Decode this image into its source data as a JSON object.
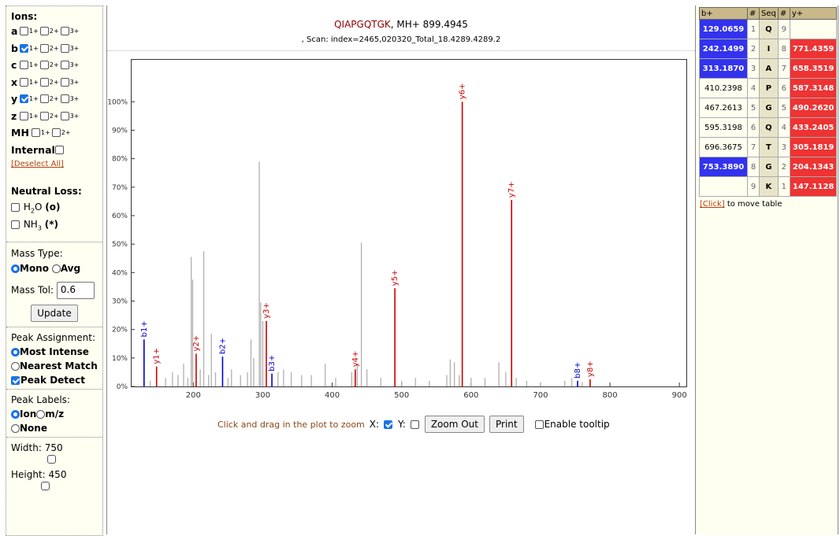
{
  "ions": {
    "heading": "Ions:",
    "rows": [
      {
        "label": "a",
        "checked": [
          false,
          false,
          false
        ]
      },
      {
        "label": "b",
        "checked": [
          true,
          false,
          false
        ]
      },
      {
        "label": "c",
        "checked": [
          false,
          false,
          false
        ]
      },
      {
        "label": "x",
        "checked": [
          false,
          false,
          false
        ]
      },
      {
        "label": "y",
        "checked": [
          true,
          false,
          false
        ]
      },
      {
        "label": "z",
        "checked": [
          false,
          false,
          false
        ]
      }
    ],
    "charge_labels": [
      "1",
      "2",
      "3"
    ],
    "charge_sup": "+",
    "mh_label": "MH",
    "internal_label": "Internal",
    "deselect_label": "[Deselect All]"
  },
  "neutral_loss": {
    "heading": "Neutral Loss:",
    "h2o_pre": "H",
    "h2o_sub": "2",
    "h2o_post": "O",
    "h2o_sym": "(o)",
    "nh3_pre": "NH",
    "nh3_sub": "3",
    "nh3_sym": "(*)"
  },
  "mass_type": {
    "heading": "Mass Type:",
    "mono": "Mono",
    "avg": "Avg",
    "tol_label": "Mass Tol:",
    "tol_value": "0.6",
    "update": "Update"
  },
  "peak_assign": {
    "heading": "Peak Assignment:",
    "most_intense": "Most Intense",
    "nearest": "Nearest Match",
    "peak_detect": "Peak Detect"
  },
  "peak_labels": {
    "heading": "Peak Labels:",
    "ion": "Ion",
    "mz": "m/z",
    "none": "None"
  },
  "size": {
    "width_label": "Width:",
    "width_value": "750",
    "height_label": "Height:",
    "height_value": "450"
  },
  "header": {
    "peptide": "QIAPGQTGK",
    "mh": ", MH+ 899.4945",
    "scan": ", Scan: index=2465,020320_Total_18.4289.4289.2"
  },
  "controls": {
    "hint": "Click and drag in the plot to zoom",
    "x": "X:",
    "y": "Y:",
    "zoom_out": "Zoom Out",
    "print": "Print",
    "tooltip": "Enable tooltip"
  },
  "chart_data": {
    "type": "bar",
    "xlim": [
      110,
      910
    ],
    "ylim": [
      0,
      115
    ],
    "xticks": [
      200,
      300,
      400,
      500,
      600,
      700,
      800,
      900
    ],
    "yticks": [
      0,
      10,
      20,
      30,
      40,
      50,
      60,
      70,
      80,
      90,
      100
    ],
    "ytick_suffix": "%",
    "grid": false,
    "colors": {
      "b": "#0000cc",
      "y": "#cc0000",
      "unassigned": "#b0b0b0"
    },
    "assigned": [
      {
        "label": "b1+",
        "mz": 129.07,
        "intensity": 16.5,
        "type": "b"
      },
      {
        "label": "y1+",
        "mz": 147.11,
        "intensity": 7,
        "type": "y"
      },
      {
        "label": "y2+",
        "mz": 204.13,
        "intensity": 11.5,
        "type": "y"
      },
      {
        "label": "b2+",
        "mz": 242.15,
        "intensity": 10.5,
        "type": "b"
      },
      {
        "label": "y3+",
        "mz": 305.18,
        "intensity": 23,
        "type": "y"
      },
      {
        "label": "b3+",
        "mz": 313.19,
        "intensity": 4.5,
        "type": "b"
      },
      {
        "label": "y4+",
        "mz": 433.24,
        "intensity": 6,
        "type": "y"
      },
      {
        "label": "y5+",
        "mz": 490.26,
        "intensity": 34.5,
        "type": "y"
      },
      {
        "label": "y6+",
        "mz": 587.31,
        "intensity": 100,
        "type": "y"
      },
      {
        "label": "y7+",
        "mz": 658.35,
        "intensity": 65.5,
        "type": "y"
      },
      {
        "label": "b8+",
        "mz": 753.39,
        "intensity": 2,
        "type": "b"
      },
      {
        "label": "y8+",
        "mz": 771.44,
        "intensity": 2.5,
        "type": "y"
      }
    ],
    "unassigned": [
      {
        "mz": 138,
        "intensity": 2
      },
      {
        "mz": 160,
        "intensity": 3
      },
      {
        "mz": 170,
        "intensity": 5
      },
      {
        "mz": 178,
        "intensity": 4
      },
      {
        "mz": 186,
        "intensity": 8
      },
      {
        "mz": 192,
        "intensity": 3
      },
      {
        "mz": 197,
        "intensity": 45.5
      },
      {
        "mz": 199,
        "intensity": 37.5
      },
      {
        "mz": 210,
        "intensity": 6
      },
      {
        "mz": 215,
        "intensity": 47.5
      },
      {
        "mz": 222,
        "intensity": 4
      },
      {
        "mz": 226,
        "intensity": 18.5
      },
      {
        "mz": 232,
        "intensity": 5
      },
      {
        "mz": 250,
        "intensity": 3
      },
      {
        "mz": 255,
        "intensity": 6
      },
      {
        "mz": 268,
        "intensity": 4
      },
      {
        "mz": 278,
        "intensity": 5
      },
      {
        "mz": 283,
        "intensity": 16.5
      },
      {
        "mz": 287,
        "intensity": 10
      },
      {
        "mz": 295,
        "intensity": 79
      },
      {
        "mz": 297,
        "intensity": 29.5
      },
      {
        "mz": 300,
        "intensity": 23
      },
      {
        "mz": 322,
        "intensity": 5
      },
      {
        "mz": 330,
        "intensity": 6
      },
      {
        "mz": 341,
        "intensity": 5
      },
      {
        "mz": 356,
        "intensity": 4
      },
      {
        "mz": 370,
        "intensity": 4
      },
      {
        "mz": 390,
        "intensity": 8
      },
      {
        "mz": 405,
        "intensity": 3
      },
      {
        "mz": 428,
        "intensity": 5
      },
      {
        "mz": 436,
        "intensity": 8
      },
      {
        "mz": 442,
        "intensity": 50.5
      },
      {
        "mz": 450,
        "intensity": 6
      },
      {
        "mz": 470,
        "intensity": 3
      },
      {
        "mz": 500,
        "intensity": 2
      },
      {
        "mz": 520,
        "intensity": 3
      },
      {
        "mz": 540,
        "intensity": 2
      },
      {
        "mz": 565,
        "intensity": 4
      },
      {
        "mz": 570,
        "intensity": 9.5
      },
      {
        "mz": 576,
        "intensity": 8.5
      },
      {
        "mz": 583,
        "intensity": 4
      },
      {
        "mz": 600,
        "intensity": 3
      },
      {
        "mz": 620,
        "intensity": 3
      },
      {
        "mz": 640,
        "intensity": 8.5
      },
      {
        "mz": 650,
        "intensity": 5
      },
      {
        "mz": 665,
        "intensity": 3
      },
      {
        "mz": 680,
        "intensity": 2
      },
      {
        "mz": 700,
        "intensity": 1.5
      },
      {
        "mz": 735,
        "intensity": 2
      },
      {
        "mz": 745,
        "intensity": 3
      },
      {
        "mz": 760,
        "intensity": 1.5
      }
    ]
  },
  "frag_table": {
    "headers": [
      "b+",
      "#",
      "Seq",
      "#",
      "y+"
    ],
    "rows": [
      {
        "b": "129.0659",
        "i": "1",
        "aa": "Q",
        "j": "9",
        "y": "",
        "bh": true,
        "yh": false
      },
      {
        "b": "242.1499",
        "i": "2",
        "aa": "I",
        "j": "8",
        "y": "771.4359",
        "bh": true,
        "yh": true
      },
      {
        "b": "313.1870",
        "i": "3",
        "aa": "A",
        "j": "7",
        "y": "658.3519",
        "bh": true,
        "yh": true
      },
      {
        "b": "410.2398",
        "i": "4",
        "aa": "P",
        "j": "6",
        "y": "587.3148",
        "bh": false,
        "yh": true
      },
      {
        "b": "467.2613",
        "i": "5",
        "aa": "G",
        "j": "5",
        "y": "490.2620",
        "bh": false,
        "yh": true
      },
      {
        "b": "595.3198",
        "i": "6",
        "aa": "Q",
        "j": "4",
        "y": "433.2405",
        "bh": false,
        "yh": true
      },
      {
        "b": "696.3675",
        "i": "7",
        "aa": "T",
        "j": "3",
        "y": "305.1819",
        "bh": false,
        "yh": true
      },
      {
        "b": "753.3890",
        "i": "8",
        "aa": "G",
        "j": "2",
        "y": "204.1343",
        "bh": true,
        "yh": true
      },
      {
        "b": "",
        "i": "9",
        "aa": "K",
        "j": "1",
        "y": "147.1128",
        "bh": false,
        "yh": true
      }
    ],
    "click_link": "[Click]",
    "click_text": " to move table"
  }
}
